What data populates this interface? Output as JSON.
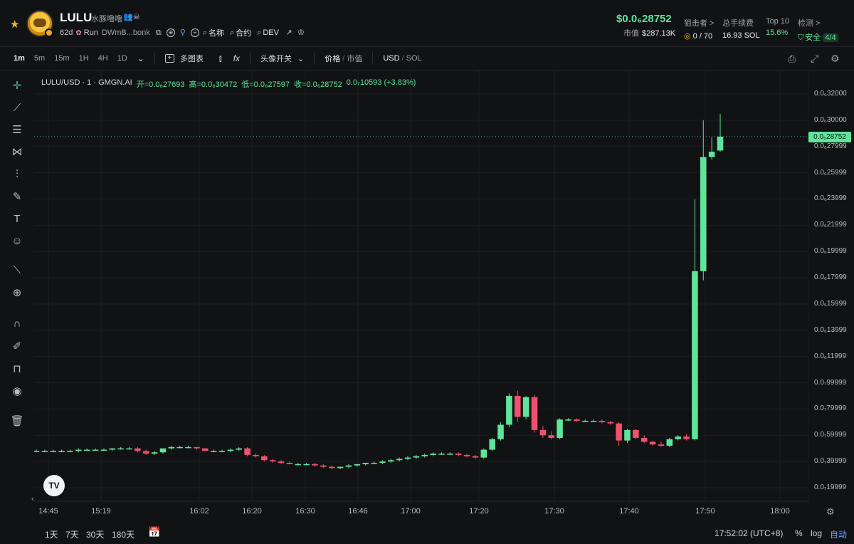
{
  "header": {
    "symbol": "LULU",
    "name": "水豚噜噜",
    "age": "62d",
    "platform": "Run",
    "address": "DWmB...bonk",
    "links": {
      "name": "名称",
      "contract": "合约",
      "dev": "DEV"
    },
    "price": "$0.0₆28752",
    "market_cap_label": "市值",
    "market_cap": "$287.13K",
    "stats": [
      {
        "label": "狙击者 >",
        "value": "0 / 70"
      },
      {
        "label": "总手续费",
        "value": "16.93 SOL"
      },
      {
        "label": "Top 10",
        "value": "15.6%"
      },
      {
        "label": "检测 >",
        "value": "安全",
        "badge": "4/4"
      }
    ]
  },
  "toolbar": {
    "timeframes": [
      "1m",
      "5m",
      "15m",
      "1H",
      "4H",
      "1D"
    ],
    "active_timeframe": "1m",
    "multi_chart": "多图表",
    "indicators_icon": "fx",
    "position_toggle": "头像开关",
    "price_label": "价格",
    "mcap_label": "市值",
    "currency_usd": "USD",
    "currency_sol": "SOL"
  },
  "legend": {
    "pair": "LULU/USD · 1 · GMGN.AI",
    "open": "开=0.0₆27693",
    "high": "高=0.0₆30472",
    "low": "低=0.0₆27597",
    "close": "收=0.0₆28752",
    "change": "0.0₇10593 (+3.83%)"
  },
  "axis": {
    "y_labels": [
      "0.0₆32000",
      "0.0₆30000",
      "0.0₆27999",
      "0.0₆25999",
      "0.0₆23999",
      "0.0₆21999",
      "0.0₆19999",
      "0.0₆17999",
      "0.0₆15999",
      "0.0₆13999",
      "0.0₆11999",
      "0.0₇99999",
      "0.0₇79999",
      "0.0₇59999",
      "0.0₇39999",
      "0.0₇19999"
    ],
    "x_labels": [
      "14:45",
      "15:19",
      "16:02",
      "16:20",
      "16:30",
      "16:46",
      "17:00",
      "17:20",
      "17:30",
      "17:40",
      "17:50",
      "18:00"
    ],
    "current_price_tag": "0.0₆28752"
  },
  "chart_data": {
    "type": "candlestick",
    "unit": "USD (×1e-6)",
    "ylim": [
      0.01,
      0.33
    ],
    "colors": {
      "up": "#5ee59a",
      "down": "#f0506e"
    },
    "candles": [
      {
        "o": 0.048,
        "h": 0.049,
        "l": 0.047,
        "c": 0.048
      },
      {
        "o": 0.048,
        "h": 0.049,
        "l": 0.047,
        "c": 0.048
      },
      {
        "o": 0.048,
        "h": 0.049,
        "l": 0.047,
        "c": 0.048
      },
      {
        "o": 0.048,
        "h": 0.049,
        "l": 0.047,
        "c": 0.048
      },
      {
        "o": 0.048,
        "h": 0.049,
        "l": 0.047,
        "c": 0.048
      },
      {
        "o": 0.048,
        "h": 0.05,
        "l": 0.047,
        "c": 0.049
      },
      {
        "o": 0.049,
        "h": 0.05,
        "l": 0.048,
        "c": 0.049
      },
      {
        "o": 0.049,
        "h": 0.05,
        "l": 0.048,
        "c": 0.049
      },
      {
        "o": 0.049,
        "h": 0.05,
        "l": 0.048,
        "c": 0.049
      },
      {
        "o": 0.049,
        "h": 0.05,
        "l": 0.048,
        "c": 0.05
      },
      {
        "o": 0.05,
        "h": 0.051,
        "l": 0.049,
        "c": 0.05
      },
      {
        "o": 0.05,
        "h": 0.051,
        "l": 0.049,
        "c": 0.05
      },
      {
        "o": 0.05,
        "h": 0.051,
        "l": 0.047,
        "c": 0.048
      },
      {
        "o": 0.048,
        "h": 0.049,
        "l": 0.045,
        "c": 0.046
      },
      {
        "o": 0.046,
        "h": 0.048,
        "l": 0.045,
        "c": 0.047
      },
      {
        "o": 0.047,
        "h": 0.05,
        "l": 0.046,
        "c": 0.05
      },
      {
        "o": 0.05,
        "h": 0.052,
        "l": 0.049,
        "c": 0.051
      },
      {
        "o": 0.051,
        "h": 0.052,
        "l": 0.05,
        "c": 0.051
      },
      {
        "o": 0.051,
        "h": 0.052,
        "l": 0.05,
        "c": 0.051
      },
      {
        "o": 0.051,
        "h": 0.051,
        "l": 0.049,
        "c": 0.05
      },
      {
        "o": 0.05,
        "h": 0.05,
        "l": 0.048,
        "c": 0.048
      },
      {
        "o": 0.048,
        "h": 0.049,
        "l": 0.047,
        "c": 0.048
      },
      {
        "o": 0.048,
        "h": 0.049,
        "l": 0.047,
        "c": 0.048
      },
      {
        "o": 0.048,
        "h": 0.05,
        "l": 0.047,
        "c": 0.049
      },
      {
        "o": 0.049,
        "h": 0.051,
        "l": 0.048,
        "c": 0.05
      },
      {
        "o": 0.05,
        "h": 0.051,
        "l": 0.044,
        "c": 0.045
      },
      {
        "o": 0.045,
        "h": 0.046,
        "l": 0.043,
        "c": 0.044
      },
      {
        "o": 0.044,
        "h": 0.045,
        "l": 0.04,
        "c": 0.041
      },
      {
        "o": 0.041,
        "h": 0.042,
        "l": 0.039,
        "c": 0.04
      },
      {
        "o": 0.04,
        "h": 0.041,
        "l": 0.038,
        "c": 0.039
      },
      {
        "o": 0.039,
        "h": 0.04,
        "l": 0.038,
        "c": 0.038
      },
      {
        "o": 0.038,
        "h": 0.039,
        "l": 0.037,
        "c": 0.038
      },
      {
        "o": 0.038,
        "h": 0.039,
        "l": 0.037,
        "c": 0.038
      },
      {
        "o": 0.038,
        "h": 0.039,
        "l": 0.036,
        "c": 0.037
      },
      {
        "o": 0.037,
        "h": 0.038,
        "l": 0.035,
        "c": 0.036
      },
      {
        "o": 0.036,
        "h": 0.037,
        "l": 0.034,
        "c": 0.035
      },
      {
        "o": 0.035,
        "h": 0.036,
        "l": 0.034,
        "c": 0.036
      },
      {
        "o": 0.036,
        "h": 0.038,
        "l": 0.035,
        "c": 0.037
      },
      {
        "o": 0.037,
        "h": 0.038,
        "l": 0.036,
        "c": 0.038
      },
      {
        "o": 0.038,
        "h": 0.039,
        "l": 0.037,
        "c": 0.039
      },
      {
        "o": 0.039,
        "h": 0.04,
        "l": 0.038,
        "c": 0.039
      },
      {
        "o": 0.039,
        "h": 0.041,
        "l": 0.038,
        "c": 0.04
      },
      {
        "o": 0.04,
        "h": 0.042,
        "l": 0.039,
        "c": 0.041
      },
      {
        "o": 0.041,
        "h": 0.043,
        "l": 0.04,
        "c": 0.042
      },
      {
        "o": 0.042,
        "h": 0.044,
        "l": 0.041,
        "c": 0.043
      },
      {
        "o": 0.043,
        "h": 0.045,
        "l": 0.042,
        "c": 0.044
      },
      {
        "o": 0.044,
        "h": 0.046,
        "l": 0.043,
        "c": 0.045
      },
      {
        "o": 0.045,
        "h": 0.047,
        "l": 0.044,
        "c": 0.046
      },
      {
        "o": 0.046,
        "h": 0.047,
        "l": 0.045,
        "c": 0.046
      },
      {
        "o": 0.046,
        "h": 0.047,
        "l": 0.045,
        "c": 0.046
      },
      {
        "o": 0.046,
        "h": 0.047,
        "l": 0.044,
        "c": 0.045
      },
      {
        "o": 0.045,
        "h": 0.046,
        "l": 0.043,
        "c": 0.044
      },
      {
        "o": 0.044,
        "h": 0.045,
        "l": 0.042,
        "c": 0.043
      },
      {
        "o": 0.043,
        "h": 0.05,
        "l": 0.042,
        "c": 0.049
      },
      {
        "o": 0.049,
        "h": 0.058,
        "l": 0.048,
        "c": 0.057
      },
      {
        "o": 0.057,
        "h": 0.07,
        "l": 0.056,
        "c": 0.068
      },
      {
        "o": 0.068,
        "h": 0.092,
        "l": 0.066,
        "c": 0.09
      },
      {
        "o": 0.09,
        "h": 0.094,
        "l": 0.07,
        "c": 0.074
      },
      {
        "o": 0.074,
        "h": 0.09,
        "l": 0.072,
        "c": 0.089
      },
      {
        "o": 0.089,
        "h": 0.091,
        "l": 0.062,
        "c": 0.064
      },
      {
        "o": 0.064,
        "h": 0.067,
        "l": 0.058,
        "c": 0.06
      },
      {
        "o": 0.06,
        "h": 0.063,
        "l": 0.057,
        "c": 0.058
      },
      {
        "o": 0.058,
        "h": 0.073,
        "l": 0.057,
        "c": 0.072
      },
      {
        "o": 0.072,
        "h": 0.073,
        "l": 0.071,
        "c": 0.072
      },
      {
        "o": 0.072,
        "h": 0.073,
        "l": 0.07,
        "c": 0.071
      },
      {
        "o": 0.071,
        "h": 0.072,
        "l": 0.07,
        "c": 0.071
      },
      {
        "o": 0.071,
        "h": 0.072,
        "l": 0.07,
        "c": 0.071
      },
      {
        "o": 0.071,
        "h": 0.072,
        "l": 0.069,
        "c": 0.07
      },
      {
        "o": 0.07,
        "h": 0.071,
        "l": 0.068,
        "c": 0.069
      },
      {
        "o": 0.069,
        "h": 0.07,
        "l": 0.052,
        "c": 0.056
      },
      {
        "o": 0.056,
        "h": 0.065,
        "l": 0.054,
        "c": 0.064
      },
      {
        "o": 0.064,
        "h": 0.065,
        "l": 0.057,
        "c": 0.058
      },
      {
        "o": 0.058,
        "h": 0.06,
        "l": 0.054,
        "c": 0.055
      },
      {
        "o": 0.055,
        "h": 0.056,
        "l": 0.052,
        "c": 0.053
      },
      {
        "o": 0.053,
        "h": 0.055,
        "l": 0.051,
        "c": 0.052
      },
      {
        "o": 0.052,
        "h": 0.058,
        "l": 0.051,
        "c": 0.057
      },
      {
        "o": 0.057,
        "h": 0.06,
        "l": 0.056,
        "c": 0.059
      },
      {
        "o": 0.059,
        "h": 0.061,
        "l": 0.056,
        "c": 0.057
      },
      {
        "o": 0.057,
        "h": 0.24,
        "l": 0.056,
        "c": 0.185
      },
      {
        "o": 0.185,
        "h": 0.3,
        "l": 0.178,
        "c": 0.272
      },
      {
        "o": 0.272,
        "h": 0.287,
        "l": 0.27,
        "c": 0.276
      },
      {
        "o": 0.27693,
        "h": 0.30472,
        "l": 0.27597,
        "c": 0.28752
      }
    ]
  },
  "footer": {
    "ranges": [
      "1天",
      "7天",
      "30天",
      "180天"
    ],
    "clock": "17:52:02 (UTC+8)",
    "percent": "%",
    "log": "log",
    "auto": "自动"
  }
}
